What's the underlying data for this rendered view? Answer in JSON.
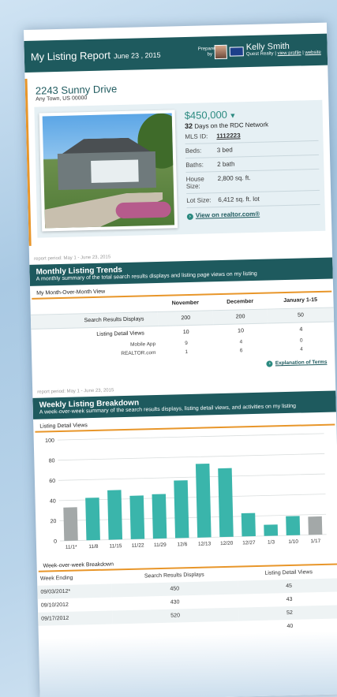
{
  "header": {
    "title": "My Listing Report",
    "date": "June 23 , 2015",
    "prepared_by": "Prepared by",
    "agent_name": "Kelly Smith",
    "agent_company": "Quest Realty",
    "view_profile": "view profile",
    "website": "website"
  },
  "listing": {
    "address": "2243 Sunny Drive",
    "city": "Any Town, US 00000",
    "price": "$450,000",
    "price_trend_icon": "down-arrow-icon",
    "days_count": "32",
    "days_label": "Days on the RDC Network",
    "rows": [
      {
        "k": "MLS ID:",
        "v": "1112223"
      },
      {
        "k": "Beds:",
        "v": "3 bed"
      },
      {
        "k": "Baths:",
        "v": "2 bath"
      },
      {
        "k": "House Size:",
        "v": "2,800 sq. ft."
      },
      {
        "k": "Lot Size:",
        "v": "6,412 sq. ft. lot"
      }
    ],
    "realtor_link": "View on realtor.com®"
  },
  "monthly": {
    "period": "report period: May 1 - June 23, 2015",
    "title": "Monthly Listing Trends",
    "subtitle": "A monthly summary of the total search results displays and listing page views on my listing",
    "table_title": "My Month-Over-Month View",
    "columns": [
      "November",
      "December",
      "January 1-15"
    ],
    "rows": [
      {
        "label": "Search Results Displays",
        "values": [
          "200",
          "200",
          "50"
        ]
      },
      {
        "label": "Listing Detail Views",
        "values": [
          "10",
          "10",
          "4"
        ]
      }
    ],
    "subrows": [
      {
        "label": "Mobile App",
        "values": [
          "9",
          "4",
          "0"
        ]
      },
      {
        "label": "REALTOR.com",
        "values": [
          "1",
          "6",
          "4"
        ]
      }
    ],
    "explanation_link": "Explanation of Terms"
  },
  "weekly": {
    "period": "report period: May 1 - June 23, 2015",
    "title": "Weekly Listing Breakdown",
    "subtitle": "A week-over-week summary of the search results displays, listing detail views, and activities on my listing",
    "chart_title": "Listing Detail Views",
    "table_title": "Week-over-week Breakdown",
    "table_headers": [
      "Week Ending",
      "Search Results Displays",
      "Listing Detail Views"
    ],
    "table_rows": [
      [
        "09/03/2012*",
        "450",
        "45"
      ],
      [
        "09/10/2012",
        "430",
        "43"
      ],
      [
        "09/17/2012",
        "520",
        "52"
      ],
      [
        "",
        "",
        "40"
      ]
    ]
  },
  "colors": {
    "header": "#1e5a5e",
    "accent": "#e8962a",
    "bar": "#3ab5ab",
    "bar_gray": "#a3a8a8"
  },
  "chart_data": {
    "type": "bar",
    "title": "Listing Detail Views",
    "categories": [
      "11/1*",
      "11/8",
      "11/15",
      "11/22",
      "11/29",
      "12/6",
      "12/13",
      "12/20",
      "12/27",
      "1/3",
      "1/10",
      "1/17"
    ],
    "values": [
      33,
      42,
      49,
      43,
      44,
      57,
      73,
      68,
      23,
      11,
      19,
      18
    ],
    "highlight": [
      true,
      false,
      false,
      false,
      false,
      false,
      false,
      false,
      false,
      false,
      false,
      true
    ],
    "ylim": [
      0,
      100
    ],
    "yticks": [
      0,
      20,
      40,
      60,
      80,
      100
    ],
    "grid": true
  }
}
